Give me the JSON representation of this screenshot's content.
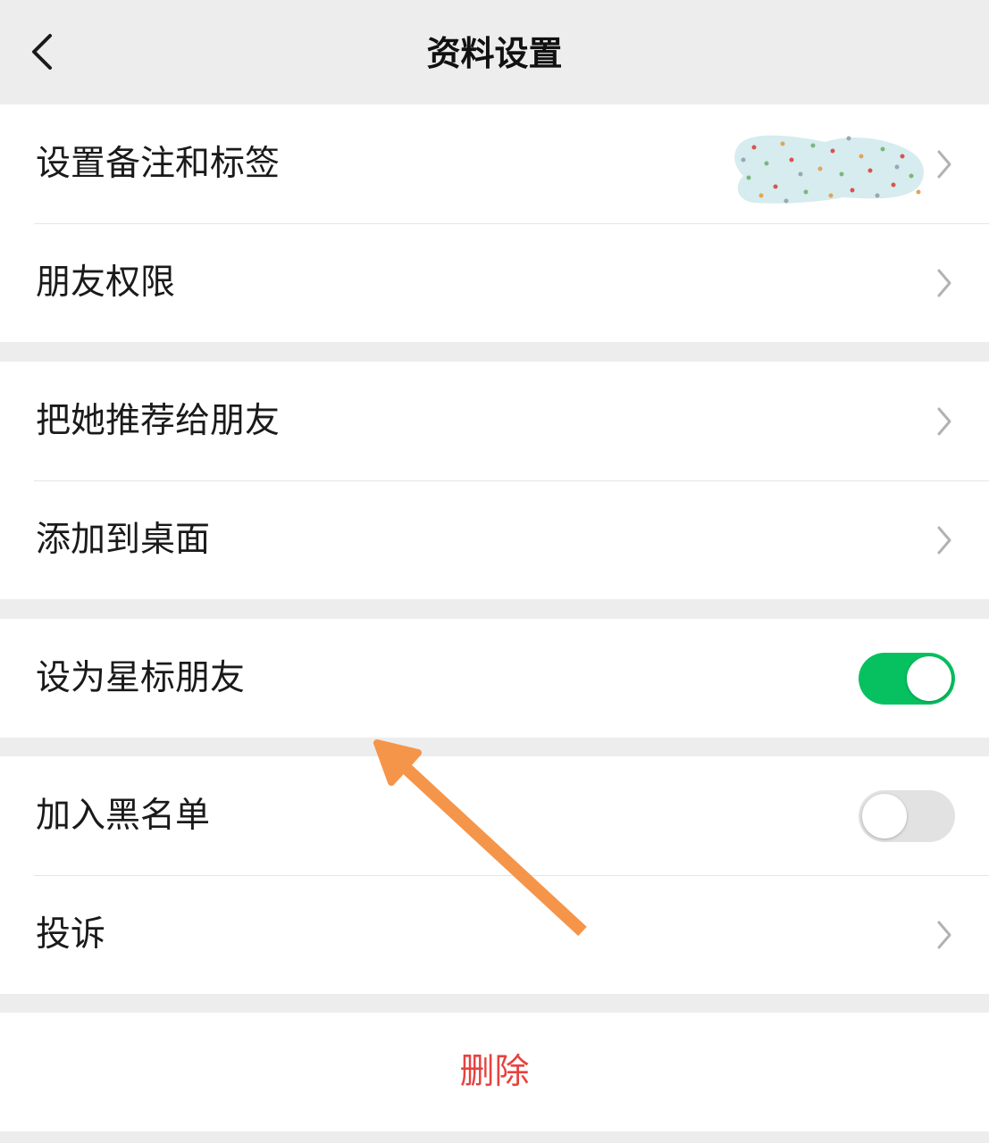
{
  "header": {
    "title": "资料设置",
    "back_icon": "chevron-left-icon"
  },
  "group_remark": {
    "items": [
      {
        "label": "设置备注和标签",
        "value_masked": true
      },
      {
        "label": "朋友权限"
      }
    ]
  },
  "group_share": {
    "items": [
      {
        "label": "把她推荐给朋友"
      },
      {
        "label": "添加到桌面"
      }
    ]
  },
  "group_star": {
    "label": "设为星标朋友",
    "toggle_on": true
  },
  "group_block": {
    "blacklist_label": "加入黑名单",
    "blacklist_on": false,
    "report_label": "投诉"
  },
  "delete": {
    "label": "删除"
  },
  "colors": {
    "page_bg": "#ededed",
    "toggle_on": "#07c160",
    "toggle_off": "#e2e2e2",
    "danger": "#e64340",
    "annotation_arrow": "#f5954a"
  }
}
